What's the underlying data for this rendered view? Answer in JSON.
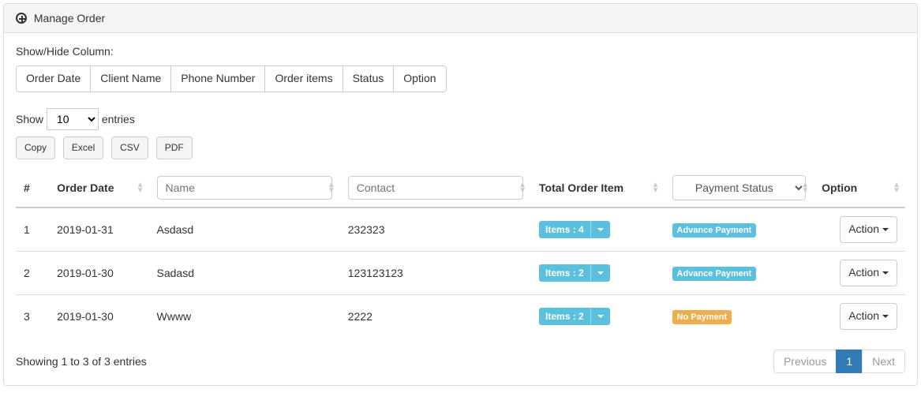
{
  "heading": "Manage Order",
  "colvis": {
    "label": "Show/Hide Column:",
    "buttons": [
      "Order Date",
      "Client Name",
      "Phone Number",
      "Order items",
      "Status",
      "Option"
    ]
  },
  "length": {
    "prefix": "Show",
    "value": "10",
    "suffix": "entries"
  },
  "export_buttons": [
    "Copy",
    "Excel",
    "CSV",
    "PDF"
  ],
  "columns": {
    "index": "#",
    "order_date": "Order Date",
    "name_placeholder": "Name",
    "contact_placeholder": "Contact",
    "total_item": "Total Order Item",
    "payment_status_placeholder": "Payment Status",
    "option": "Option"
  },
  "items_prefix": "Items :",
  "action_label": "Action",
  "payment_labels": {
    "advance": "Advance Payment",
    "none": "No Payment"
  },
  "rows": [
    {
      "idx": "1",
      "date": "2019-01-31",
      "name": "Asdasd",
      "contact": "232323",
      "items": "4",
      "pay": "advance"
    },
    {
      "idx": "2",
      "date": "2019-01-30",
      "name": "Sadasd",
      "contact": "123123123",
      "items": "2",
      "pay": "advance"
    },
    {
      "idx": "3",
      "date": "2019-01-30",
      "name": "Wwww",
      "contact": "2222",
      "items": "2",
      "pay": "none"
    }
  ],
  "info": "Showing 1 to 3 of 3 entries",
  "pagination": {
    "prev": "Previous",
    "page": "1",
    "next": "Next"
  }
}
